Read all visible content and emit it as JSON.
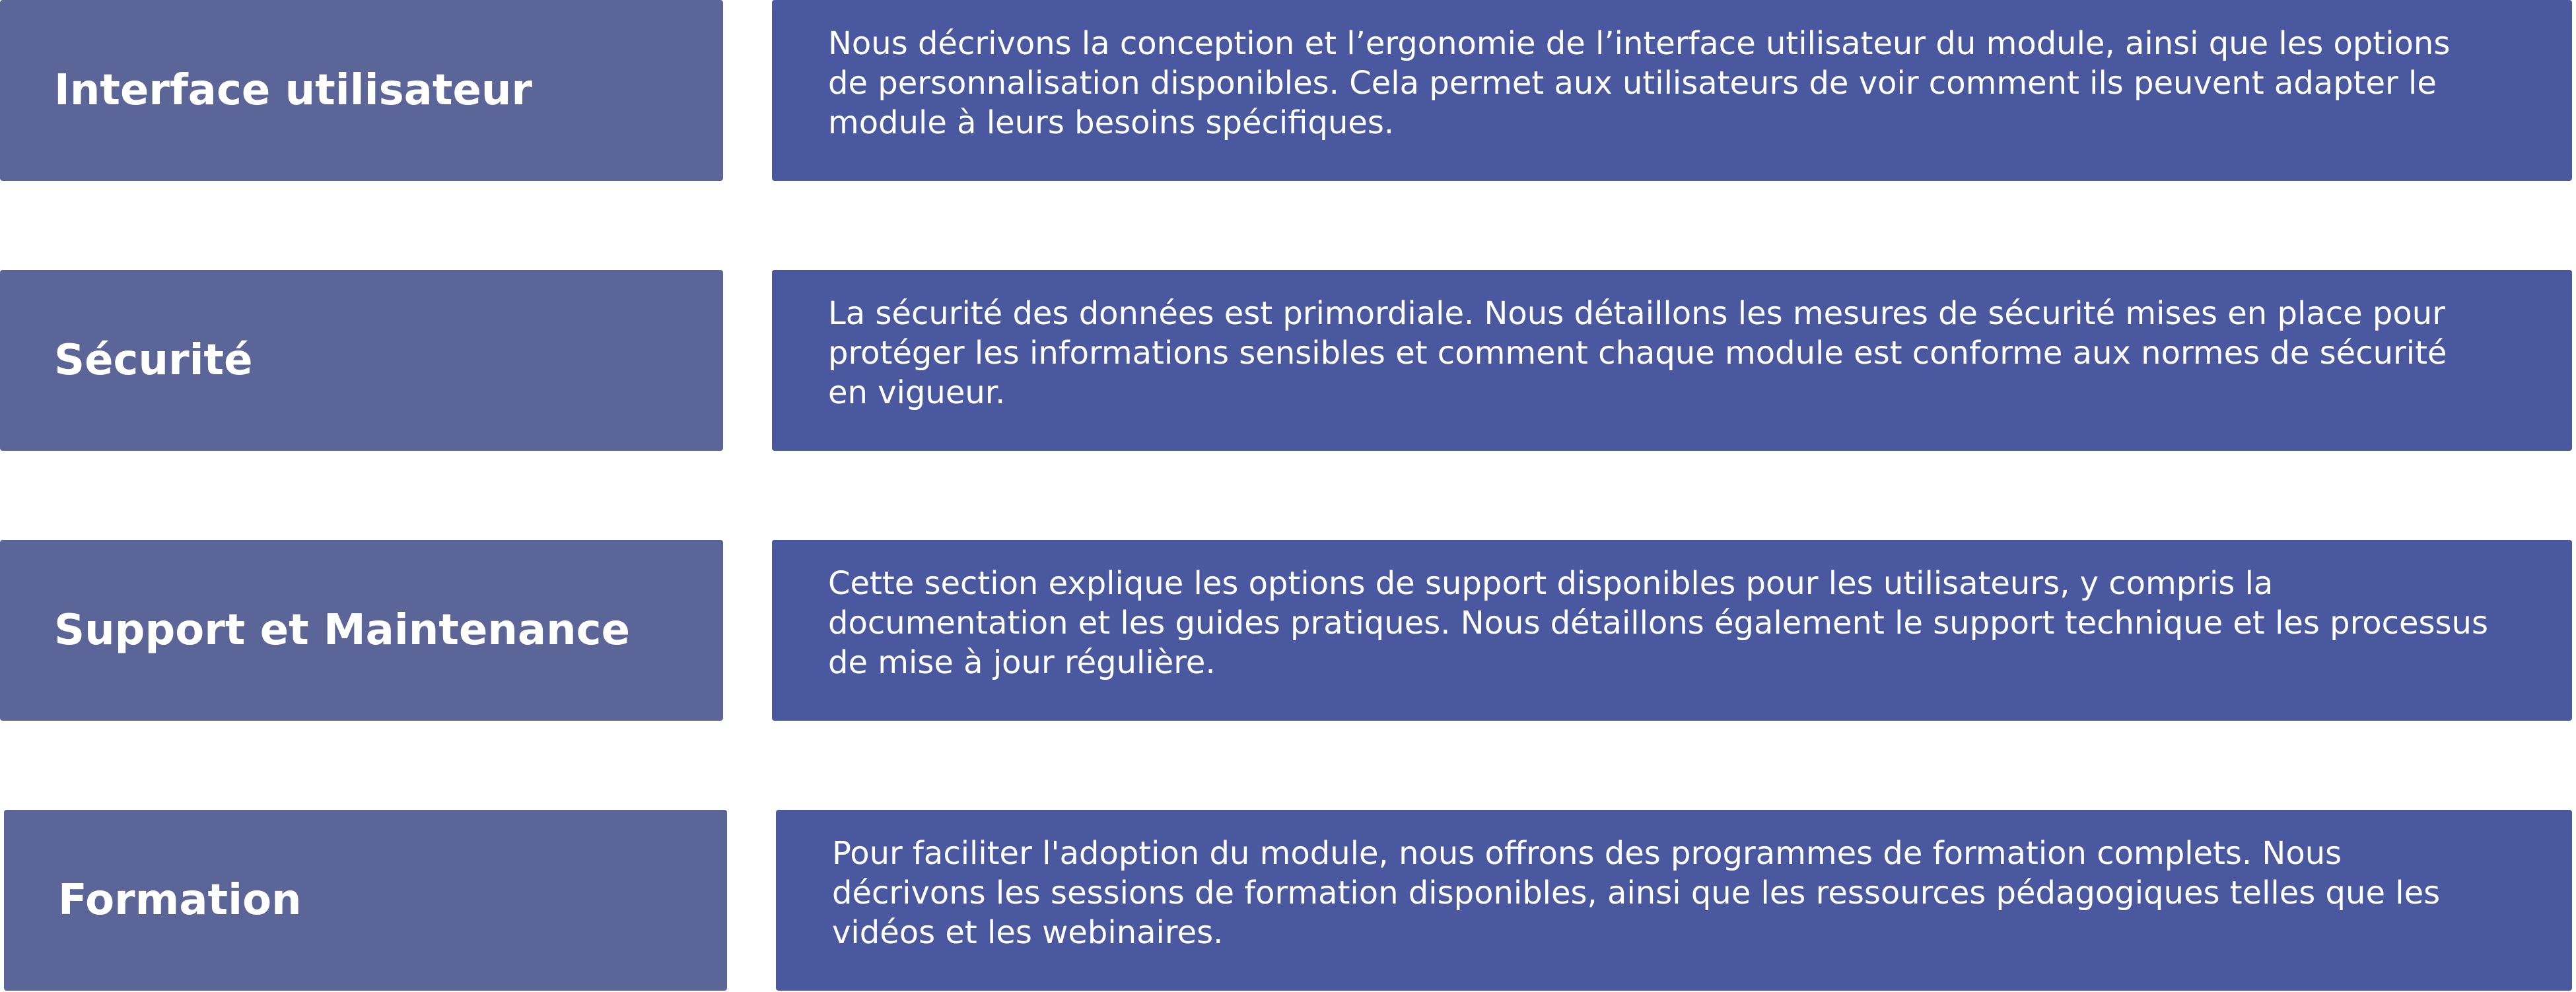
{
  "colors": {
    "label_box": "#5c6598",
    "desc_box": "#4a599f",
    "text": "#ffffff",
    "background": "#ffffff"
  },
  "rows": [
    {
      "label": "Interface utilisateur",
      "description": "Nous décrivons la conception et l’ergonomie de l’interface utilisateur du module, ainsi que les options de personnalisation disponibles. Cela permet aux utilisateurs de voir comment ils peuvent adapter le module à leurs besoins spécifiques."
    },
    {
      "label": "Sécurité",
      "description": "La sécurité des données est primordiale. Nous détaillons les mesures de sécurité mises en place pour protéger les informations sensibles et comment chaque module est conforme aux normes de sécurité en vigueur."
    },
    {
      "label": "Support et Maintenance",
      "description": "Cette section explique les options de support disponibles pour les utilisateurs, y compris la documentation et les guides pratiques. Nous détaillons également le support technique et les processus de mise à jour régulière."
    },
    {
      "label": "Formation",
      "description": "Pour faciliter l'adoption du module, nous offrons des programmes de formation complets. Nous décrivons les sessions de formation disponibles, ainsi que les ressources pédagogiques telles que les vidéos et les webinaires."
    }
  ]
}
